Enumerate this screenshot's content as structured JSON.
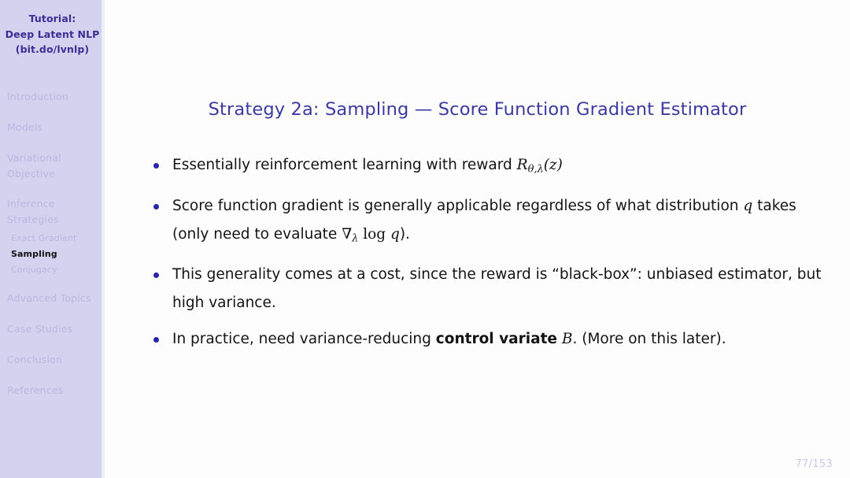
{
  "sidebar": {
    "title_lines": [
      "Tutorial:",
      "Deep Latent NLP",
      "(bit.do/lvnlp)"
    ],
    "sections": [
      {
        "label": "Introduction",
        "current": false
      },
      {
        "label": "Models",
        "current": false
      },
      {
        "label": "Variational",
        "label2": "Objective",
        "current": false
      },
      {
        "label": "Inference",
        "label2": "Strategies",
        "current": false
      },
      {
        "label": "Advanced Topics",
        "current": false
      },
      {
        "label": "Case Studies",
        "current": false
      },
      {
        "label": "Conclusion",
        "current": false
      },
      {
        "label": "References",
        "current": false
      }
    ],
    "subsections": [
      {
        "label": "Exact Gradient",
        "current": false
      },
      {
        "label": "Sampling",
        "current": true
      },
      {
        "label": "Conjugacy",
        "current": false
      }
    ]
  },
  "slide": {
    "title": "Strategy 2a: Sampling — Score Function Gradient Estimator",
    "page_number": "77/153",
    "bullets": [
      {
        "parts": [
          {
            "text": "Essentially reinforcement learning with reward ",
            "style": "normal"
          },
          {
            "text": "R",
            "style": "math"
          },
          {
            "text": "θ,λ",
            "style": "math-sub"
          },
          {
            "text": "(z)",
            "style": "math"
          }
        ]
      },
      {
        "parts": [
          {
            "text": "Score function gradient is generally applicable regardless of what distribution ",
            "style": "normal"
          },
          {
            "text": "q",
            "style": "math"
          },
          {
            "text": " takes (only need to evaluate ",
            "style": "normal"
          },
          {
            "text": "∇",
            "style": "math-upright"
          },
          {
            "text": "λ",
            "style": "math-sub"
          },
          {
            "text": " log ",
            "style": "math-upright"
          },
          {
            "text": "q",
            "style": "math"
          },
          {
            "text": ").",
            "style": "normal"
          }
        ]
      },
      {
        "parts": [
          {
            "text": "This generality comes at a cost, since the reward is “black-box”: unbiased estimator, but high variance.",
            "style": "normal"
          }
        ]
      },
      {
        "parts": [
          {
            "text": "In practice, need variance-reducing ",
            "style": "normal"
          },
          {
            "text": "control variate",
            "style": "bold"
          },
          {
            "text": " ",
            "style": "normal"
          },
          {
            "text": "B",
            "style": "math"
          },
          {
            "text": ". (More on this later).",
            "style": "normal"
          }
        ]
      }
    ]
  },
  "colors": {
    "sidebar_bg": "#d3d2ef",
    "sidebar_title_text": "#3b2f96",
    "nav_inactive_text": "#b9b8e0",
    "nav_active_text": "#141414",
    "title_text": "#3b3a9e",
    "bullet_marker": "#2a25a8",
    "body_text": "#141414",
    "page_number_text": "#c9c8e6",
    "main_bg": "#fdfdfd"
  }
}
